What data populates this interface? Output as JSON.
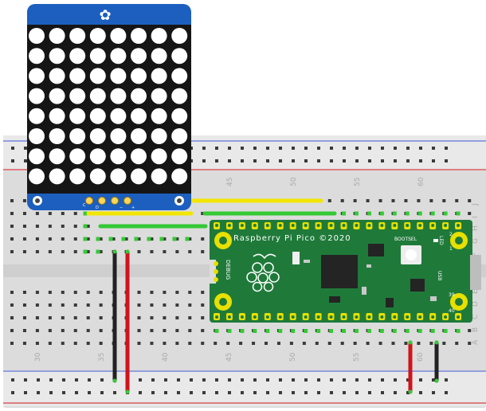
{
  "breadboard": {
    "column_numbers_top": [
      "45",
      "50",
      "55",
      "60"
    ],
    "column_numbers_bottom": [
      "30",
      "35",
      "40",
      "45",
      "50",
      "55",
      "60"
    ],
    "row_letters_right_top": [
      "J",
      "I",
      "H",
      "G",
      "F"
    ],
    "row_letters_right_bottom": [
      "E",
      "D",
      "C",
      "B",
      "A"
    ]
  },
  "matrix": {
    "rows": 8,
    "cols": 8,
    "logo_glyph": "✿",
    "pin_labels": [
      "C",
      "D",
      "−",
      "+"
    ]
  },
  "pico": {
    "title": "Raspberry Pi Pico ©2020",
    "bootsel_label": "BOOTSEL",
    "debug_label": "DEBUG",
    "led_label": "LED",
    "usb_label": "USB",
    "pin_marks": [
      "2",
      "1",
      "39",
      "40"
    ]
  },
  "colors": {
    "board_blue": "#1d5fbf",
    "pico_green": "#1f7a3a",
    "wire_yellow": "#f2e600",
    "wire_green": "#35c935",
    "wire_red": "#d0131b",
    "wire_black": "#222222",
    "rail_red": "#d0131b",
    "rail_blue": "#3a57d6"
  }
}
